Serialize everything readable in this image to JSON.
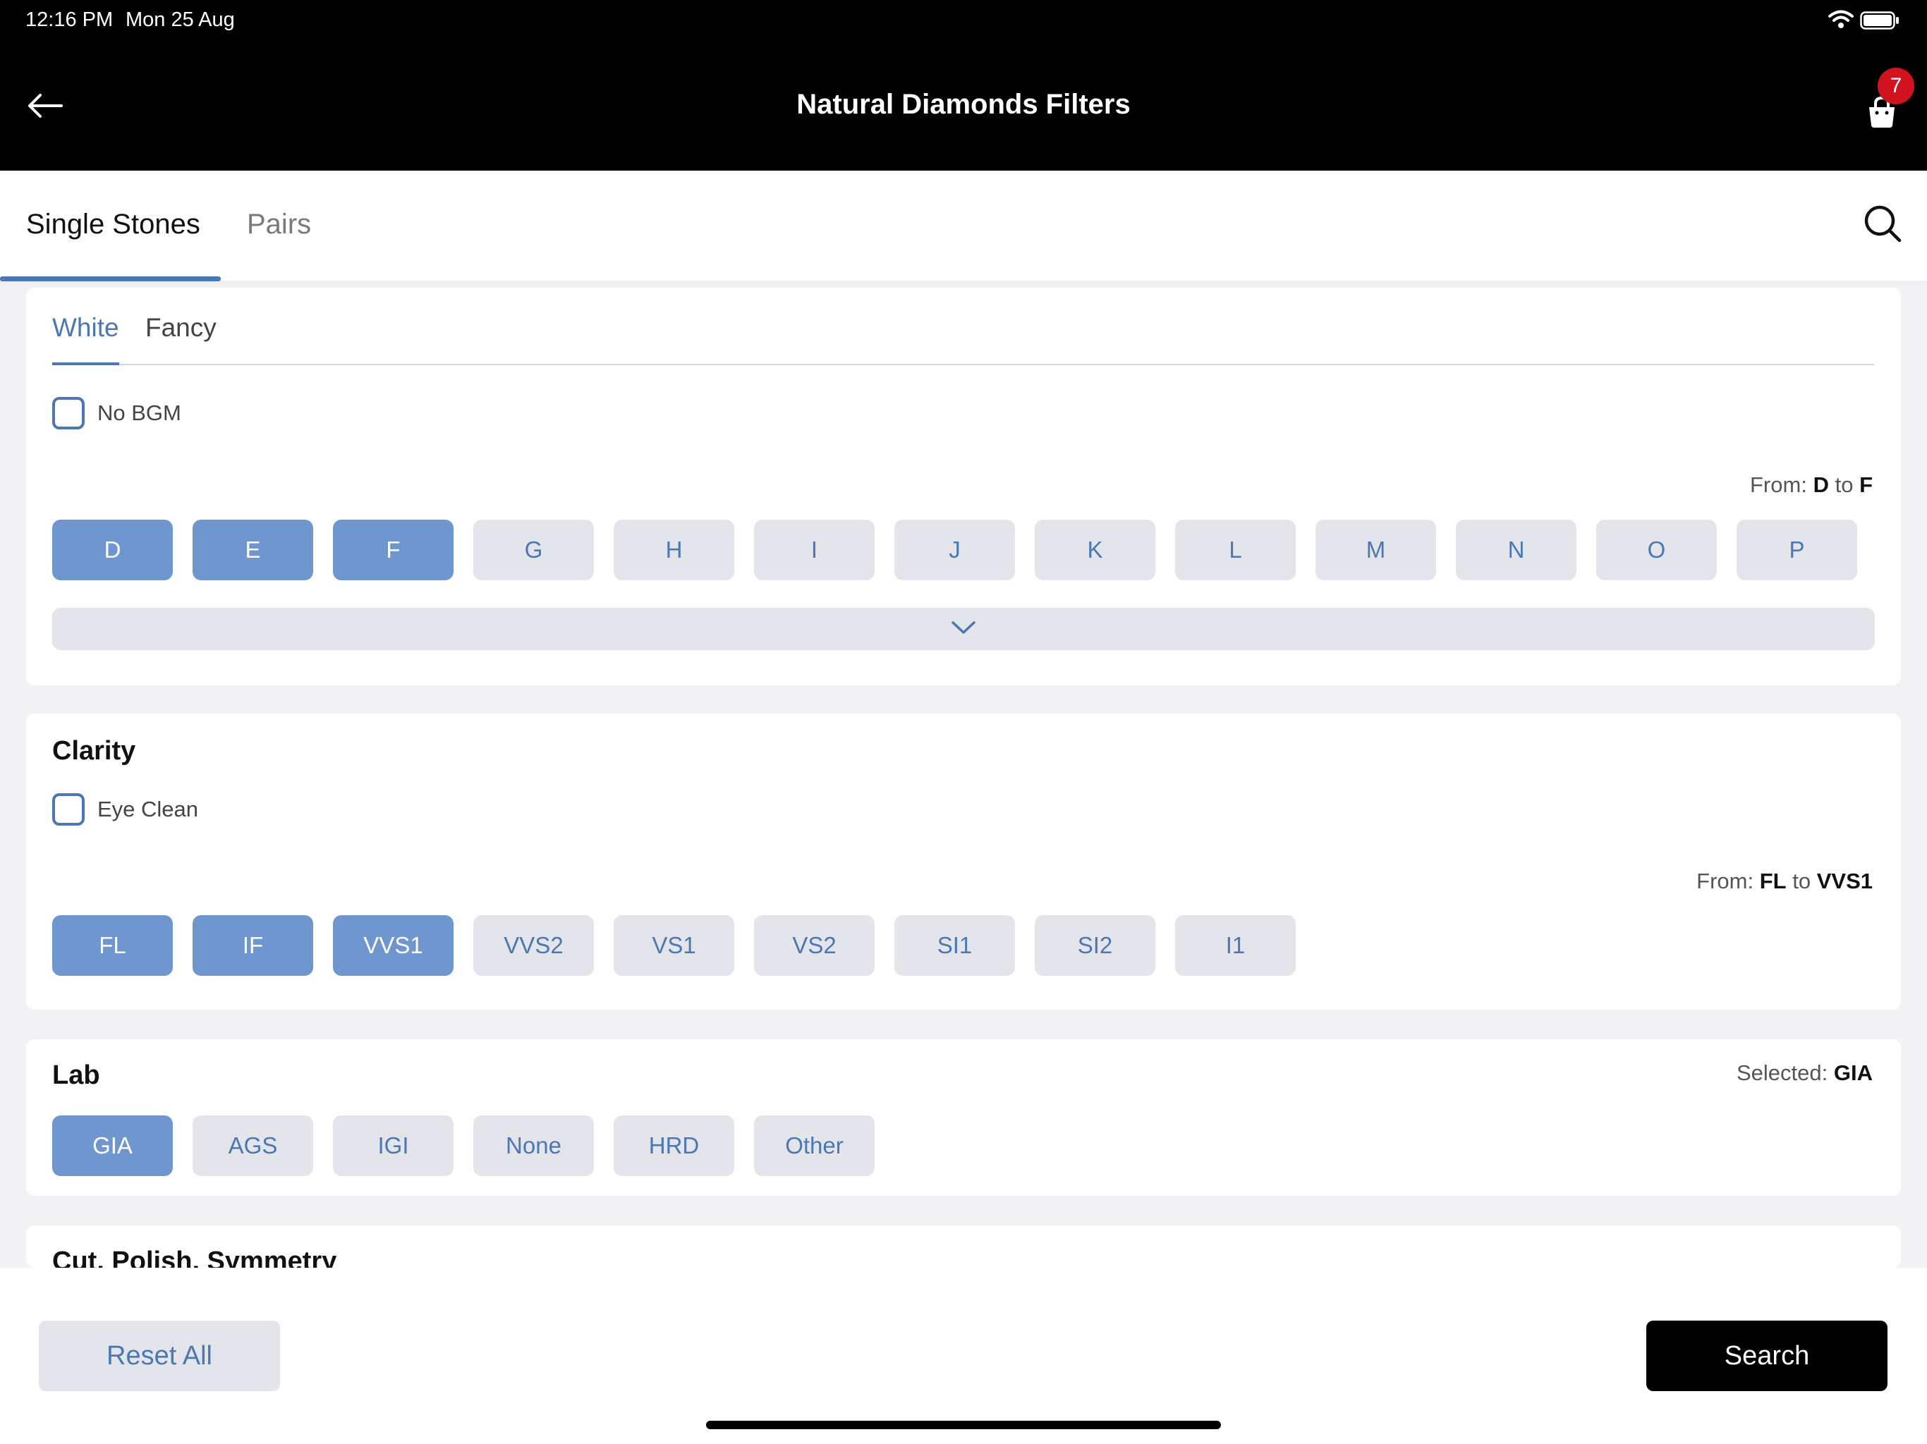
{
  "status_bar": {
    "time": "12:16 PM",
    "date": "Mon 25 Aug"
  },
  "nav": {
    "title": "Natural Diamonds Filters",
    "cart_count": "7"
  },
  "tabs": [
    {
      "label": "Single Stones",
      "active": true
    },
    {
      "label": "Pairs",
      "active": false
    }
  ],
  "color_section": {
    "subtabs": [
      {
        "label": "White",
        "active": true
      },
      {
        "label": "Fancy",
        "active": false
      }
    ],
    "no_bgm_label": "No BGM",
    "range": {
      "prefix": "From:",
      "from": "D",
      "sep": "to",
      "to": "F"
    },
    "grades": [
      {
        "label": "D",
        "selected": true
      },
      {
        "label": "E",
        "selected": true
      },
      {
        "label": "F",
        "selected": true
      },
      {
        "label": "G",
        "selected": false
      },
      {
        "label": "H",
        "selected": false
      },
      {
        "label": "I",
        "selected": false
      },
      {
        "label": "J",
        "selected": false
      },
      {
        "label": "K",
        "selected": false
      },
      {
        "label": "L",
        "selected": false
      },
      {
        "label": "M",
        "selected": false
      },
      {
        "label": "N",
        "selected": false
      },
      {
        "label": "O",
        "selected": false
      },
      {
        "label": "P",
        "selected": false
      }
    ]
  },
  "clarity_section": {
    "title": "Clarity",
    "eye_clean_label": "Eye Clean",
    "range": {
      "prefix": "From:",
      "from": "FL",
      "sep": "to",
      "to": "VVS1"
    },
    "grades": [
      {
        "label": "FL",
        "selected": true
      },
      {
        "label": "IF",
        "selected": true
      },
      {
        "label": "VVS1",
        "selected": true
      },
      {
        "label": "VVS2",
        "selected": false
      },
      {
        "label": "VS1",
        "selected": false
      },
      {
        "label": "VS2",
        "selected": false
      },
      {
        "label": "SI1",
        "selected": false
      },
      {
        "label": "SI2",
        "selected": false
      },
      {
        "label": "I1",
        "selected": false
      }
    ]
  },
  "lab_section": {
    "title": "Lab",
    "selected_prefix": "Selected:",
    "selected_value": "GIA",
    "options": [
      {
        "label": "GIA",
        "selected": true
      },
      {
        "label": "AGS",
        "selected": false
      },
      {
        "label": "IGI",
        "selected": false
      },
      {
        "label": "None",
        "selected": false
      },
      {
        "label": "HRD",
        "selected": false
      },
      {
        "label": "Other",
        "selected": false
      }
    ]
  },
  "cut_section": {
    "title": "Cut, Polish, Symmetry"
  },
  "footer": {
    "reset_label": "Reset All",
    "search_label": "Search"
  },
  "colors": {
    "accent": "#4b78b4",
    "chip_selected": "#6f96cf",
    "chip_default": "#e3e5ea",
    "badge": "#d1121f"
  }
}
